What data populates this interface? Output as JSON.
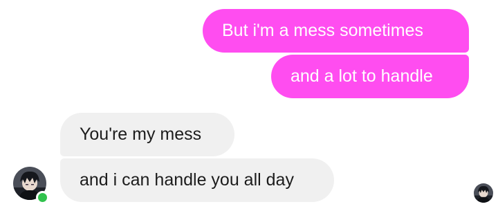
{
  "messages": [
    {
      "direction": "outgoing",
      "text": "But i'm a mess sometimes"
    },
    {
      "direction": "outgoing",
      "text": "and a lot to handle"
    },
    {
      "direction": "incoming",
      "text": "You're my mess"
    },
    {
      "direction": "incoming",
      "text": "and i can handle you all day"
    }
  ],
  "contact": {
    "avatar_icon": "contact-avatar-icon",
    "online_status_color": "#31c24d"
  },
  "read_receipt": {
    "icon": "read-receipt-avatar-icon"
  },
  "colors": {
    "outgoing_bubble": "#ff4df0",
    "incoming_bubble": "#f0f0f0",
    "outgoing_text": "#ffffff",
    "incoming_text": "#1c1c1c"
  }
}
